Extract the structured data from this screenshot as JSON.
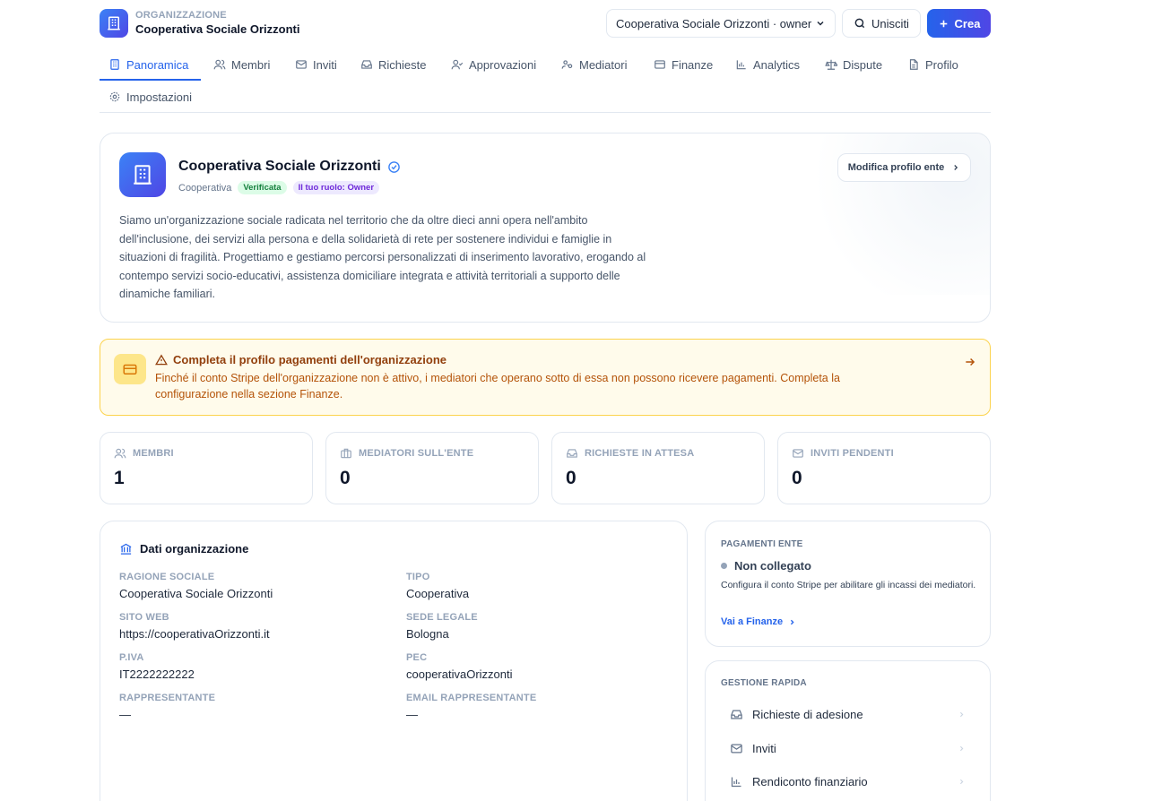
{
  "header": {
    "org_caption": "ORGANIZZAZIONE",
    "org_name": "Cooperativa Sociale Orizzonti",
    "org_select_value": "Cooperativa Sociale Orizzonti · owner",
    "join_label": "Unisciti",
    "create_label": "Crea"
  },
  "tabs": [
    {
      "label": "Panoramica",
      "icon": "building-icon",
      "active": true
    },
    {
      "label": "Membri",
      "icon": "users-icon"
    },
    {
      "label": "Inviti",
      "icon": "mail-icon"
    },
    {
      "label": "Richieste",
      "icon": "inbox-icon"
    },
    {
      "label": "Approvazioni",
      "icon": "user-check-icon"
    },
    {
      "label": "Mediatori",
      "icon": "mediators-icon"
    },
    {
      "label": "Finanze",
      "icon": "credit-card-icon"
    },
    {
      "label": "Analytics",
      "icon": "bar-chart-icon"
    },
    {
      "label": "Dispute",
      "icon": "scale-icon"
    },
    {
      "label": "Profilo",
      "icon": "file-icon"
    },
    {
      "label": "Impostazioni",
      "icon": "gear-icon"
    }
  ],
  "profile": {
    "name": "Cooperativa Sociale Orizzonti",
    "type": "Cooperativa",
    "verified_badge": "Verificata",
    "role_badge": "Il tuo ruolo: Owner",
    "description": "Siamo un'organizzazione sociale radicata nel territorio che da oltre dieci anni opera nell'ambito dell'inclusione, dei servizi alla persona e della solidarietà di rete per sostenere individui e famiglie in situazioni di fragilità. Progettiamo e gestiamo percorsi personalizzati di inserimento lavorativo, erogando al contempo servizi socio-educativi, assistenza domiciliare integrata e attività territoriali a supporto delle dinamiche familiari.",
    "edit_label": "Modifica profilo ente"
  },
  "alert": {
    "title": "Completa il profilo pagamenti dell'organizzazione",
    "text": "Finché il conto Stripe dell'organizzazione non è attivo, i mediatori che operano sotto di essa non possono ricevere pagamenti. Completa la configurazione nella sezione Finanze."
  },
  "stats": [
    {
      "label": "MEMBRI",
      "value": "1",
      "icon": "users-icon"
    },
    {
      "label": "MEDIATORI SULL'ENTE",
      "value": "0",
      "icon": "briefcase-icon"
    },
    {
      "label": "RICHIESTE IN ATTESA",
      "value": "0",
      "icon": "inbox-icon"
    },
    {
      "label": "INVITI PENDENTI",
      "value": "0",
      "icon": "mail-icon"
    }
  ],
  "org_data": {
    "title": "Dati organizzazione",
    "fields": [
      {
        "label": "RAGIONE SOCIALE",
        "value": "Cooperativa Sociale Orizzonti"
      },
      {
        "label": "TIPO",
        "value": "Cooperativa"
      },
      {
        "label": "SITO WEB",
        "value": "https://cooperativaOrizzonti.it"
      },
      {
        "label": "SEDE LEGALE",
        "value": "Bologna"
      },
      {
        "label": "P.IVA",
        "value": "IT2222222222"
      },
      {
        "label": "PEC",
        "value": "cooperativaOrizzonti"
      },
      {
        "label": "RAPPRESENTANTE",
        "value": "—"
      },
      {
        "label": "EMAIL RAPPRESENTANTE",
        "value": "—"
      }
    ]
  },
  "payments": {
    "caption": "PAGAMENTI ENTE",
    "status": "Non collegato",
    "description": "Configura il conto Stripe per abilitare gli incassi dei mediatori.",
    "link_label": "Vai a Finanze"
  },
  "quick": {
    "caption": "GESTIONE RAPIDA",
    "items": [
      {
        "label": "Richieste di adesione",
        "icon": "inbox-icon"
      },
      {
        "label": "Inviti",
        "icon": "mail-icon"
      },
      {
        "label": "Rendiconto finanziario",
        "icon": "bar-chart-icon"
      }
    ]
  },
  "colors": {
    "accent": "#2563eb",
    "alert_bg": "#fffbeb",
    "alert_border": "#fcd34d",
    "alert_title": "#92400e",
    "verified": "#15803d",
    "role": "#6d28d9"
  }
}
